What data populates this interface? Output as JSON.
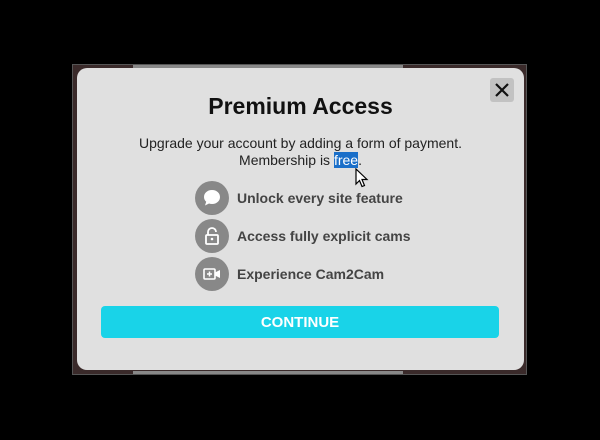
{
  "dialog": {
    "title": "Premium Access",
    "desc_line1": "Upgrade your account by adding a form of payment.",
    "desc_line2_prefix": "Membership is ",
    "desc_line2_selected": "free",
    "desc_line2_suffix": ".",
    "close_icon": "close-icon",
    "features": [
      {
        "icon": "chat-bubble-icon",
        "label": "Unlock every site feature"
      },
      {
        "icon": "unlocked-padlock-icon",
        "label": "Access fully explicit cams"
      },
      {
        "icon": "video-camera-icon",
        "label": "Experience Cam2Cam"
      }
    ],
    "continue_label": "CONTINUE"
  },
  "colors": {
    "accent": "#19d3e8",
    "dialog_bg": "#e0e0e0",
    "selection": "#1a6fc9",
    "icon_bg": "#888888"
  }
}
